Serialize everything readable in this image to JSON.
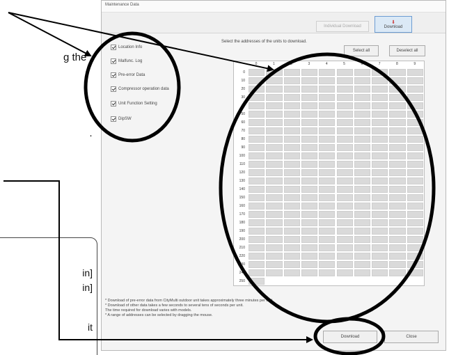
{
  "background_text": {
    "fragment_a": "g the",
    "fragment_b": "·"
  },
  "note_box": {
    "lines": [
      "in]",
      "in]",
      "it"
    ]
  },
  "dialog": {
    "title": "Maintenance Data",
    "toolbar": {
      "disabled_button": "Individual Download",
      "download_button": "Download"
    },
    "instruction": "Select the addresses of the units to download.",
    "select_all": "Select all",
    "deselect_all": "Deselect all",
    "options": [
      {
        "label": "Location Info",
        "checked": true
      },
      {
        "label": "Malfunc. Log",
        "checked": true
      },
      {
        "label": "Pre-error Data",
        "checked": true
      },
      {
        "label": "Compressor operation data",
        "checked": true
      },
      {
        "label": "Unit Function Setting",
        "checked": true
      },
      {
        "label": "DipSW",
        "checked": true
      }
    ],
    "grid": {
      "column_headers": [
        "0",
        "1",
        "2",
        "3",
        "4",
        "5",
        "6",
        "7",
        "8",
        "9"
      ],
      "row_labels": [
        "0",
        "10",
        "20",
        "30",
        "40",
        "50",
        "60",
        "70",
        "80",
        "90",
        "100",
        "110",
        "120",
        "130",
        "140",
        "150",
        "160",
        "170",
        "180",
        "190",
        "200",
        "210",
        "220",
        "230",
        "240",
        "250"
      ]
    },
    "notes": [
      "* Download of pre-error data from CityMulti outdoor unit takes approximately three minutes per unit.",
      "* Download of other data takes a few seconds to several tens of seconds per unit.",
      "The time required for download varies with models.",
      "* A range of addresses can be selected by dragging the mouse."
    ],
    "bottom_download_button": "Download",
    "close_button": "Close"
  },
  "annotation_colors": {
    "highlight_stroke": "#000000"
  }
}
